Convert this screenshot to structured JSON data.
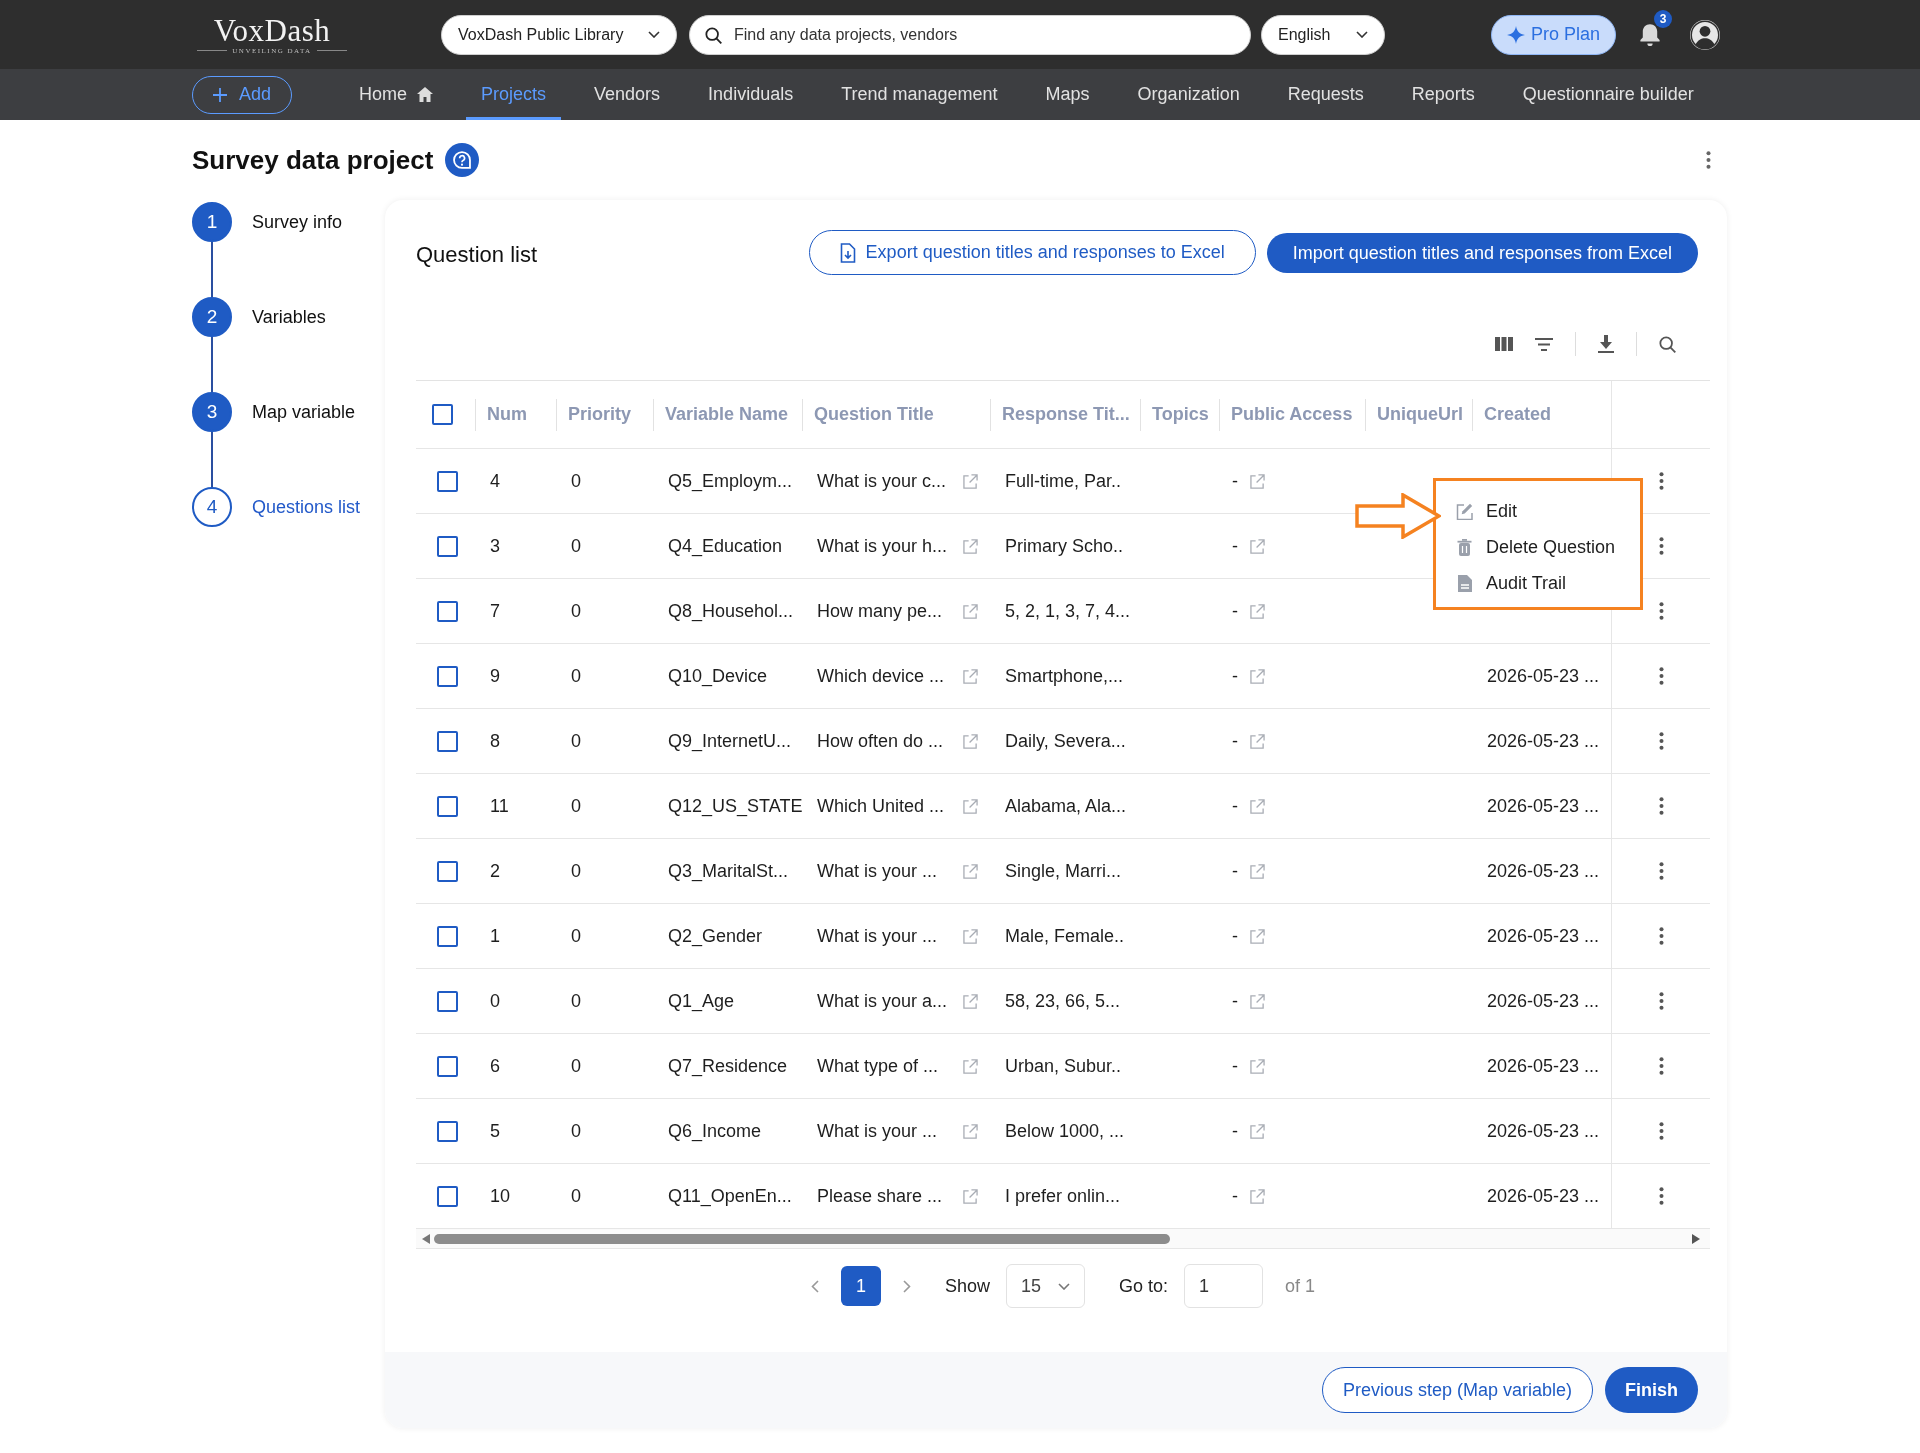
{
  "header": {
    "logo": {
      "name": "VoxDash",
      "tagline": "UNVEILING DATA"
    },
    "library_select": {
      "value": "VoxDash Public Library"
    },
    "search": {
      "placeholder": "Find any data projects, vendors"
    },
    "language_select": {
      "value": "English"
    },
    "plan_button": "Pro Plan",
    "notifications": {
      "count": "3"
    }
  },
  "nav": {
    "add_button": "Add",
    "items": [
      {
        "label": "Home",
        "kind": "home",
        "selected": false
      },
      {
        "label": "Projects",
        "kind": "text",
        "selected": true
      },
      {
        "label": "Vendors",
        "kind": "text",
        "selected": false
      },
      {
        "label": "Individuals",
        "kind": "text",
        "selected": false
      },
      {
        "label": "Trend management",
        "kind": "text",
        "selected": false
      },
      {
        "label": "Maps",
        "kind": "text",
        "selected": false
      },
      {
        "label": "Organization",
        "kind": "text",
        "selected": false
      },
      {
        "label": "Requests",
        "kind": "text",
        "selected": false
      },
      {
        "label": "Reports",
        "kind": "text",
        "selected": false
      },
      {
        "label": "Questionnaire builder",
        "kind": "text",
        "selected": false
      }
    ]
  },
  "page": {
    "title": "Survey data project"
  },
  "steps": [
    {
      "number": "1",
      "label": "Survey info",
      "selected": false
    },
    {
      "number": "2",
      "label": "Variables",
      "selected": false
    },
    {
      "number": "3",
      "label": "Map variable",
      "selected": false
    },
    {
      "number": "4",
      "label": "Questions list",
      "selected": true
    }
  ],
  "question_list": {
    "title": "Question list",
    "export_button": "Export question titles and responses to Excel",
    "import_button": "Import question titles and responses from Excel",
    "table": {
      "select_all": {
        "checked": false
      },
      "columns": [
        "Num",
        "Priority",
        "Variable Name",
        "Question Title",
        "Response Tit...",
        "Topics",
        "Public Access",
        "UniqueUrl",
        "Created"
      ],
      "rows": [
        {
          "checked": false,
          "num": "4",
          "priority": "0",
          "variable_name": "Q5_Employm...",
          "question_title": "What is your c...",
          "response_titles": "Full-time, Par..",
          "public_access": "-"
        },
        {
          "checked": false,
          "num": "3",
          "priority": "0",
          "variable_name": "Q4_Education",
          "question_title": "What is your h...",
          "response_titles": "Primary Scho..",
          "public_access": "-"
        },
        {
          "checked": false,
          "num": "7",
          "priority": "0",
          "variable_name": "Q8_Househol...",
          "question_title": "How many pe...",
          "response_titles": "5, 2, 1, 3, 7, 4...",
          "public_access": "-"
        },
        {
          "checked": false,
          "num": "9",
          "priority": "0",
          "variable_name": "Q10_Device",
          "question_title": "Which device ...",
          "response_titles": "Smartphone,...",
          "public_access": "-",
          "created": "2026-05-23 ..."
        },
        {
          "checked": false,
          "num": "8",
          "priority": "0",
          "variable_name": "Q9_InternetU...",
          "question_title": "How often do ...",
          "response_titles": "Daily, Severa...",
          "public_access": "-",
          "created": "2026-05-23 ..."
        },
        {
          "checked": false,
          "num": "11",
          "priority": "0",
          "variable_name": "Q12_US_STATE",
          "question_title": "Which United ...",
          "response_titles": "Alabama, Ala...",
          "public_access": "-",
          "created": "2026-05-23 ..."
        },
        {
          "checked": false,
          "num": "2",
          "priority": "0",
          "variable_name": "Q3_MaritalSt...",
          "question_title": "What is your ...",
          "response_titles": "Single, Marri...",
          "public_access": "-",
          "created": "2026-05-23 ..."
        },
        {
          "checked": false,
          "num": "1",
          "priority": "0",
          "variable_name": "Q2_Gender",
          "question_title": "What is your ...",
          "response_titles": "Male, Female..",
          "public_access": "-",
          "created": "2026-05-23 ..."
        },
        {
          "checked": false,
          "num": "0",
          "priority": "0",
          "variable_name": "Q1_Age",
          "question_title": "What is your a...",
          "response_titles": "58, 23, 66, 5...",
          "public_access": "-",
          "created": "2026-05-23 ..."
        },
        {
          "checked": false,
          "num": "6",
          "priority": "0",
          "variable_name": "Q7_Residence",
          "question_title": "What type of ...",
          "response_titles": "Urban, Subur..",
          "public_access": "-",
          "created": "2026-05-23 ..."
        },
        {
          "checked": false,
          "num": "5",
          "priority": "0",
          "variable_name": "Q6_Income",
          "question_title": "What is your ...",
          "response_titles": "Below 1000, ...",
          "public_access": "-",
          "created": "2026-05-23 ..."
        },
        {
          "checked": false,
          "num": "10",
          "priority": "0",
          "variable_name": "Q11_OpenEn...",
          "question_title": "Please share ...",
          "response_titles": "I prefer onlin...",
          "public_access": "-",
          "created": "2026-05-23 ..."
        }
      ]
    },
    "context_menu": {
      "items": [
        {
          "label": "Edit",
          "kind": "edit"
        },
        {
          "label": "Delete Question",
          "kind": "delete"
        },
        {
          "label": "Audit Trail",
          "kind": "audit"
        }
      ]
    },
    "pagination": {
      "pages": [
        {
          "label": "1",
          "selected": true
        }
      ],
      "show_label": "Show",
      "page_size": "15",
      "goto_label": "Go to:",
      "goto_value": "1",
      "of_label": "of 1"
    },
    "footer": {
      "previous_button": "Previous step (Map variable)",
      "finish_button": "Finish"
    }
  }
}
